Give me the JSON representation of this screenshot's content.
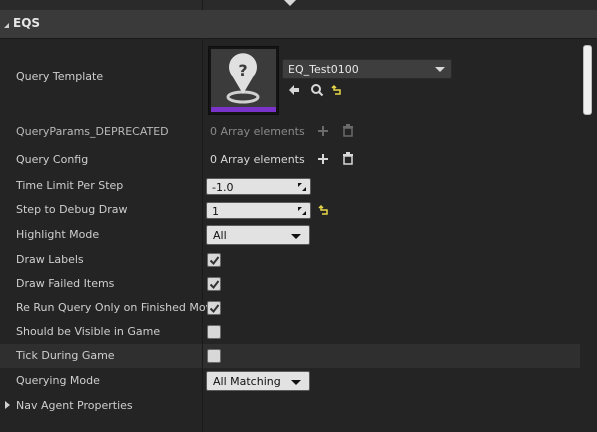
{
  "section": {
    "title": "EQS"
  },
  "query_template": {
    "label": "Query Template",
    "asset_name": "EQ_Test0100"
  },
  "query_params": {
    "label": "QueryParams_DEPRECATED",
    "value": "0 Array elements"
  },
  "query_config": {
    "label": "Query Config",
    "value": "0 Array elements"
  },
  "time_limit": {
    "label": "Time Limit Per Step",
    "value": "-1.0"
  },
  "step_debug": {
    "label": "Step to Debug Draw",
    "value": "1"
  },
  "highlight_mode": {
    "label": "Highlight Mode",
    "value": "All"
  },
  "draw_labels": {
    "label": "Draw Labels",
    "checked": true
  },
  "draw_failed": {
    "label": "Draw Failed Items",
    "checked": true
  },
  "rerun_query": {
    "label": "Re Run Query Only on Finished Move",
    "checked": true
  },
  "visible_in_game": {
    "label": "Should be Visible in Game",
    "checked": false
  },
  "tick_during_game": {
    "label": "Tick During Game",
    "checked": false
  },
  "querying_mode": {
    "label": "Querying Mode",
    "value": "All Matching"
  },
  "nav_agent": {
    "label": "Nav Agent Properties"
  },
  "icons": {
    "thumbnail": "query-placeholder-icon",
    "use_selected": "arrow-left-icon",
    "browse": "search-icon",
    "reset": "reset-to-default-icon",
    "add": "plus-icon",
    "delete": "trash-icon"
  },
  "colors": {
    "accent_purple": "#7a32c8",
    "reset_yellow": "#e8d84a"
  }
}
